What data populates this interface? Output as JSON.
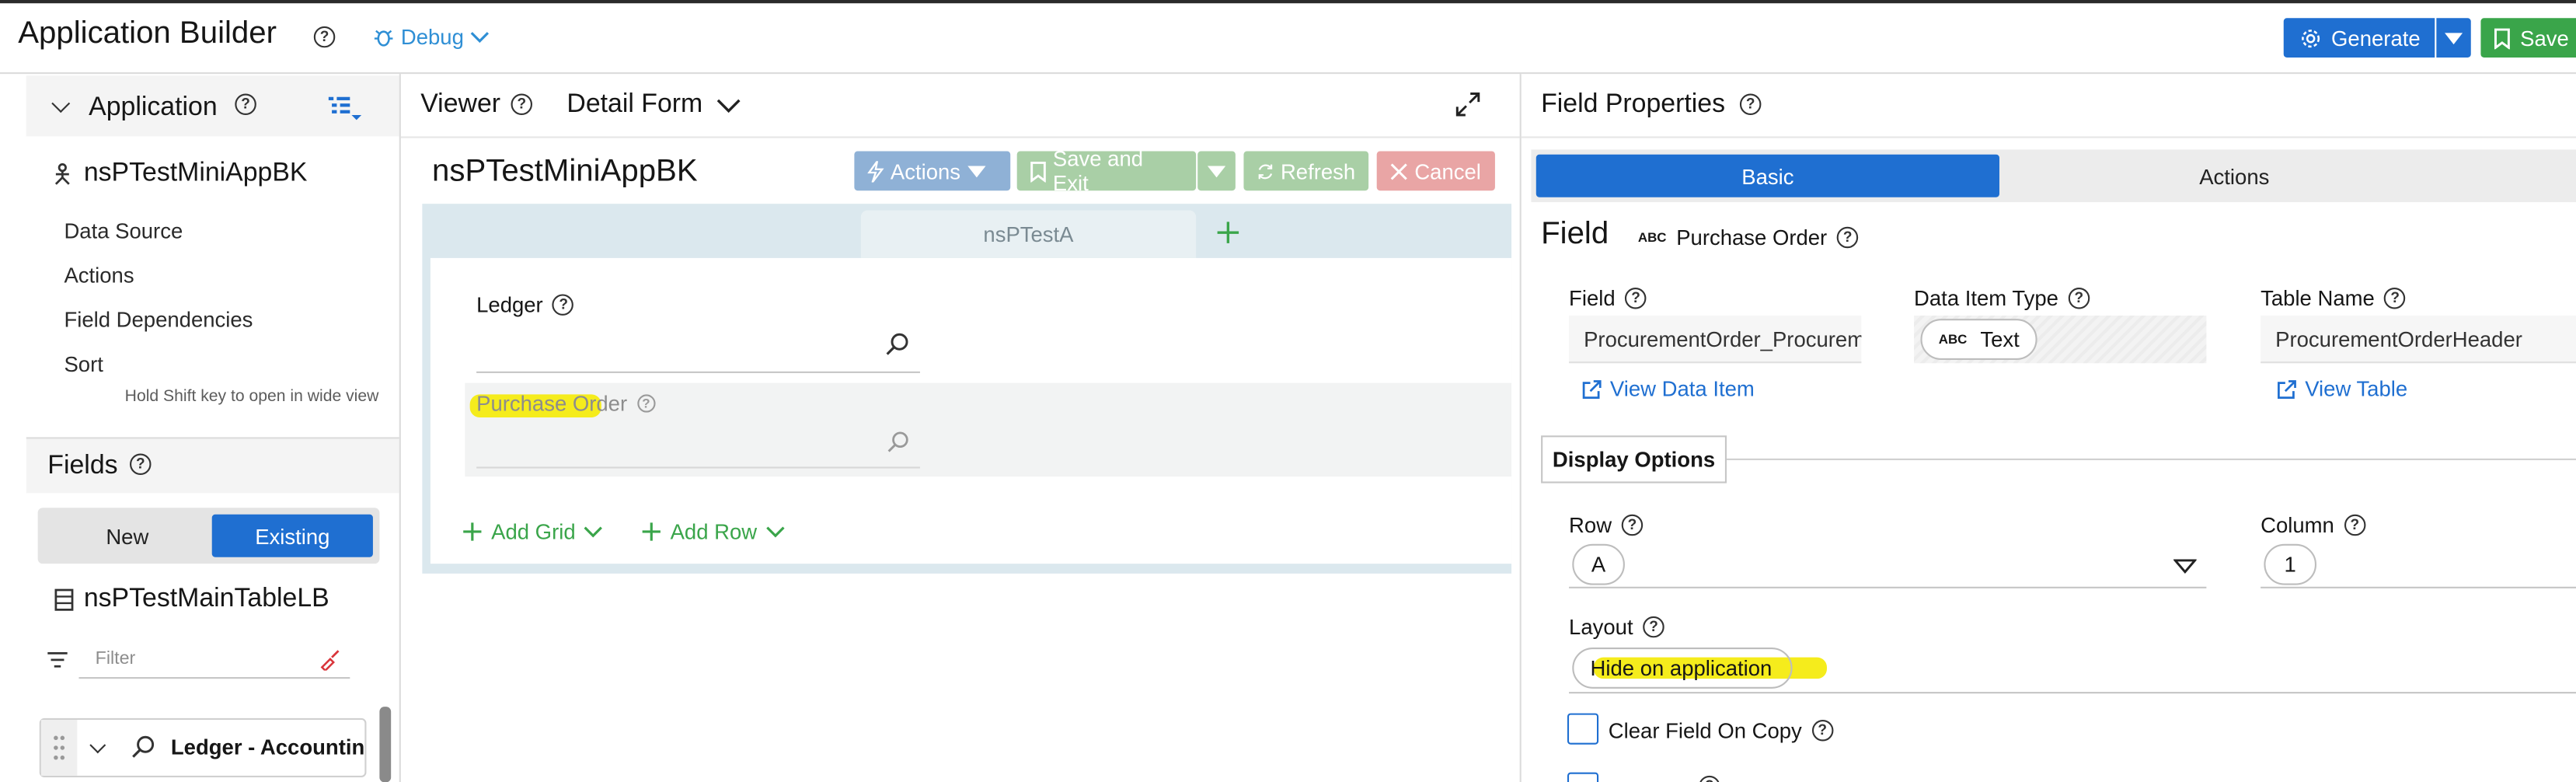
{
  "header": {
    "title": "Application Builder",
    "debug_label": "Debug",
    "generate_label": "Generate",
    "save_label": "Save"
  },
  "left_panel": {
    "application_label": "Application",
    "app_name": "nsPTestMiniAppBK",
    "nav_items": [
      "Data Source",
      "Actions",
      "Field Dependencies",
      "Sort"
    ],
    "hint": "Hold Shift key to open in wide view",
    "fields_label": "Fields",
    "segment_new": "New",
    "segment_existing": "Existing",
    "table_name": "nsPTestMainTableLB",
    "filter_placeholder": "Filter",
    "field_item": "Ledger - Accounting"
  },
  "viewer": {
    "title": "Viewer",
    "form_selector": "Detail Form",
    "form_name": "nsPTestMiniAppBK",
    "toolbar": {
      "actions": "Actions",
      "save_exit": "Save and Exit",
      "refresh": "Refresh",
      "cancel": "Cancel"
    },
    "tab_label": "nsPTestA",
    "ledger_label": "Ledger",
    "purchase_order_label": "Purchase Order",
    "add_grid": "Add Grid",
    "add_row": "Add Row"
  },
  "properties": {
    "title": "Field Properties",
    "tab_basic": "Basic",
    "tab_actions": "Actions",
    "field_heading": "Field",
    "field_type_badge": "ABC",
    "field_display_name": "Purchase Order",
    "field_label": "Field",
    "field_value": "ProcurementOrder_Procurem",
    "data_item_type_label": "Data Item Type",
    "data_item_type_badge": "ABC",
    "data_item_type_value": "Text",
    "table_name_label": "Table Name",
    "table_name_value": "ProcurementOrderHeader",
    "view_data_item": "View Data Item",
    "view_table": "View Table",
    "display_options": "Display Options",
    "row_label": "Row",
    "row_value": "A",
    "column_label": "Column",
    "column_value": "1",
    "layout_label": "Layout",
    "layout_value": "Hide on application",
    "clear_on_copy": "Clear Field On Copy"
  },
  "colors": {
    "primary_blue": "#1f6fd1",
    "save_green": "#3aa54a",
    "highlight": "#f5ec1c"
  }
}
